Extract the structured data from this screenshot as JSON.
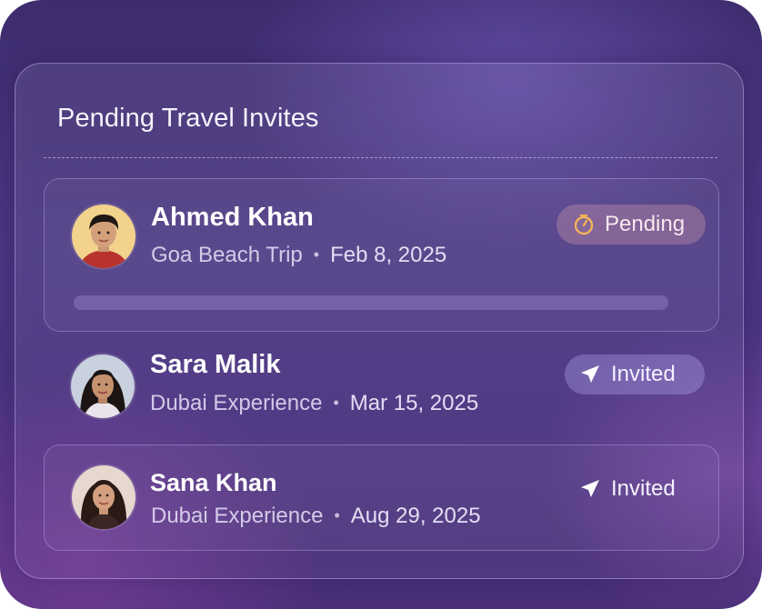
{
  "panel": {
    "title": "Pending Travel Invites"
  },
  "colors": {
    "background": "#4a3682",
    "pending_badge": "#c896aa",
    "pending_icon": "#f2b25a",
    "invited_badge": "#aa9be6",
    "text_primary": "#ffffff"
  },
  "invites": [
    {
      "name": "Ahmed Khan",
      "trip": "Goa Beach Trip",
      "separator": "•",
      "date": "Feb 8, 2025",
      "status": "Pending",
      "status_icon": "timer-icon",
      "progress": 0
    },
    {
      "name": "Sara Malik",
      "trip": "Dubai Experience",
      "separator": "•",
      "date": "Mar 15, 2025",
      "status": "Invited",
      "status_icon": "send-arrow-icon"
    },
    {
      "name": "Sana Khan",
      "trip": "Dubai Experience",
      "separator": "•",
      "date": "Aug 29, 2025",
      "status": "Invited",
      "status_icon": "send-arrow-icon"
    }
  ]
}
